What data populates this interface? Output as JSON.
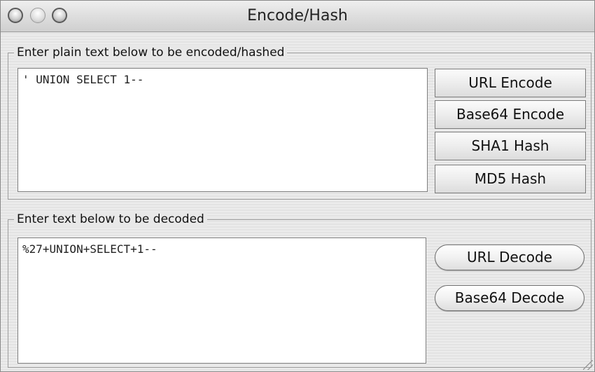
{
  "window": {
    "title": "Encode/Hash"
  },
  "encode_section": {
    "label": "Enter plain text below to be encoded/hashed",
    "input_value": "' UNION SELECT 1--",
    "buttons": {
      "url_encode": "URL Encode",
      "base64_encode": "Base64 Encode",
      "sha1_hash": "SHA1 Hash",
      "md5_hash": "MD5 Hash"
    }
  },
  "decode_section": {
    "label": "Enter text below to be decoded",
    "input_value": "%27+UNION+SELECT+1--",
    "buttons": {
      "url_decode": "URL Decode",
      "base64_decode": "Base64 Decode"
    }
  },
  "icons": {
    "close": "close-icon",
    "minimize": "minimize-icon",
    "zoom": "zoom-icon",
    "resize": "resize-grip-icon"
  }
}
